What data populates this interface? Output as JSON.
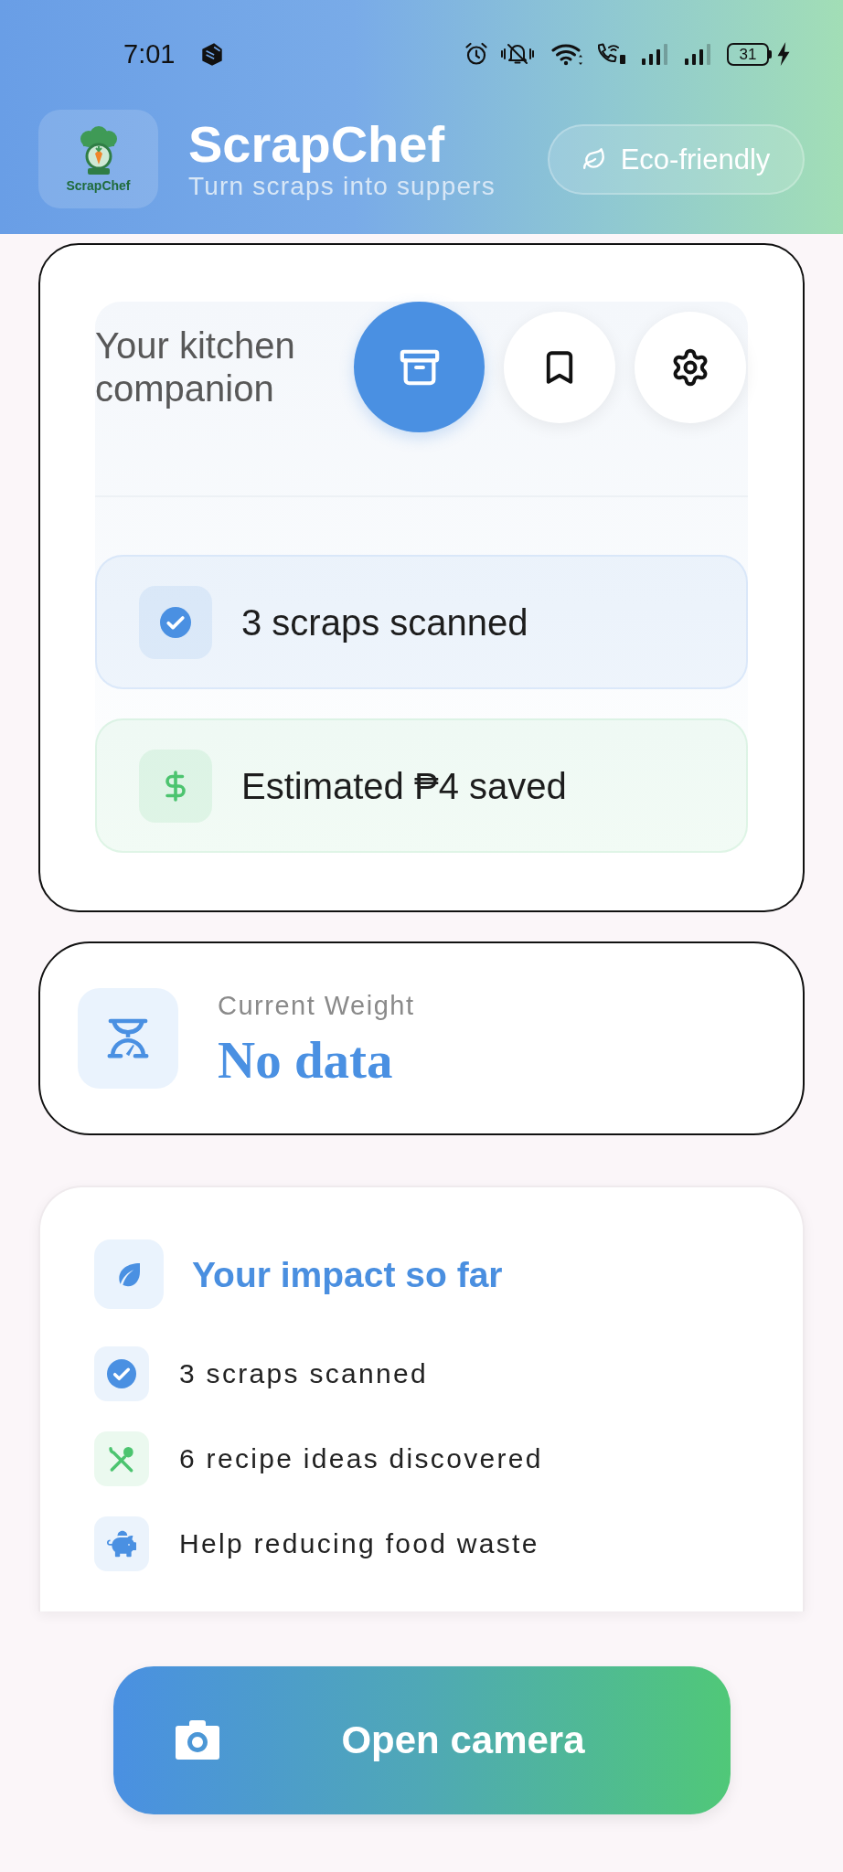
{
  "status_bar": {
    "time": "7:01",
    "battery": "31"
  },
  "header": {
    "logo_caption": "ScrapChef",
    "title": "ScrapChef",
    "subtitle": "Turn scraps into suppers",
    "badge": "Eco-friendly"
  },
  "kitchen_card": {
    "heading": "Your kitchen companion",
    "actions": [
      {
        "kind": "archive",
        "selected": true
      },
      {
        "kind": "bookmark",
        "selected": false
      },
      {
        "kind": "settings",
        "selected": false
      }
    ],
    "stats": [
      {
        "kind": "check",
        "text": "3 scraps scanned",
        "color": "#4a90e2"
      },
      {
        "kind": "money",
        "text": "Estimated ₱4 saved",
        "color": "#4cc46f"
      }
    ]
  },
  "weight_card": {
    "label": "Current Weight",
    "value": "No data"
  },
  "impact_card": {
    "title": "Your impact so far",
    "items": [
      {
        "kind": "check",
        "text": "3 scraps scanned",
        "color": "#4a90e2"
      },
      {
        "kind": "utensils",
        "text": "6 recipe ideas discovered",
        "color": "#4cc46f"
      },
      {
        "kind": "piggy_bank",
        "text": "Help reducing food waste",
        "color": "#4a90e2"
      }
    ]
  },
  "camera_button": {
    "label": "Open camera"
  }
}
